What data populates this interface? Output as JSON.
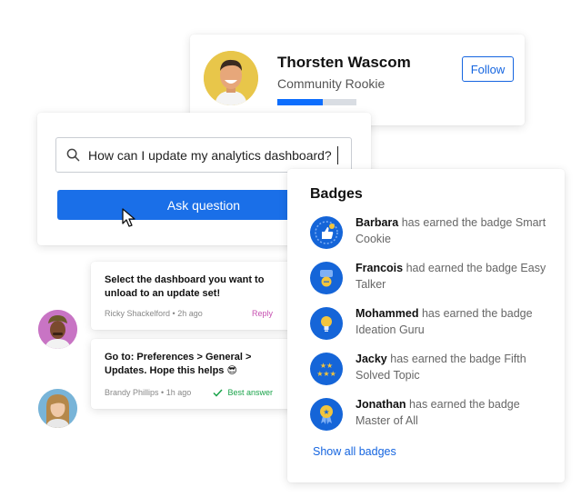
{
  "profile": {
    "name": "Thorsten Wascom",
    "rank": "Community Rookie",
    "progress": 0.57,
    "follow_label": "Follow"
  },
  "ask": {
    "search_value": "How can I update my analytics dashboard?",
    "button_label": "Ask question"
  },
  "answers": [
    {
      "body": "Select the dashboard you want to unload to an update set!",
      "author": "Ricky Shackelford",
      "time": "2h ago",
      "action": "Reply"
    },
    {
      "body": "Go to: Preferences > General > Updates. Hope this helps 😎",
      "author": "Brandy Phillips",
      "time": "1h ago",
      "action": "Best answer"
    }
  ],
  "badges": {
    "title": "Badges",
    "items": [
      {
        "user": "Barbara",
        "verb": "has earned the badge",
        "badge": "Smart Cookie",
        "icon": "thumbs-up-icon"
      },
      {
        "user": "Francois",
        "verb": "had earned the badge",
        "badge": "Easy Talker",
        "icon": "chat-icon"
      },
      {
        "user": "Mohammed",
        "verb": "has earned the badge",
        "badge": "Ideation Guru",
        "icon": "lightbulb-icon"
      },
      {
        "user": "Jacky",
        "verb": "has earned the badge",
        "badge": "Fifth Solved Topic",
        "icon": "stars-icon"
      },
      {
        "user": "Jonathan",
        "verb": "has earned the badge",
        "badge": "Master of All",
        "icon": "medal-icon"
      }
    ],
    "show_all": "Show all badges"
  },
  "colors": {
    "primary": "#1a6fe8",
    "badge_blue": "#1565d8",
    "badge_accent": "#f2c53d",
    "reply": "#c64fb0",
    "best_answer": "#1aa34a"
  }
}
